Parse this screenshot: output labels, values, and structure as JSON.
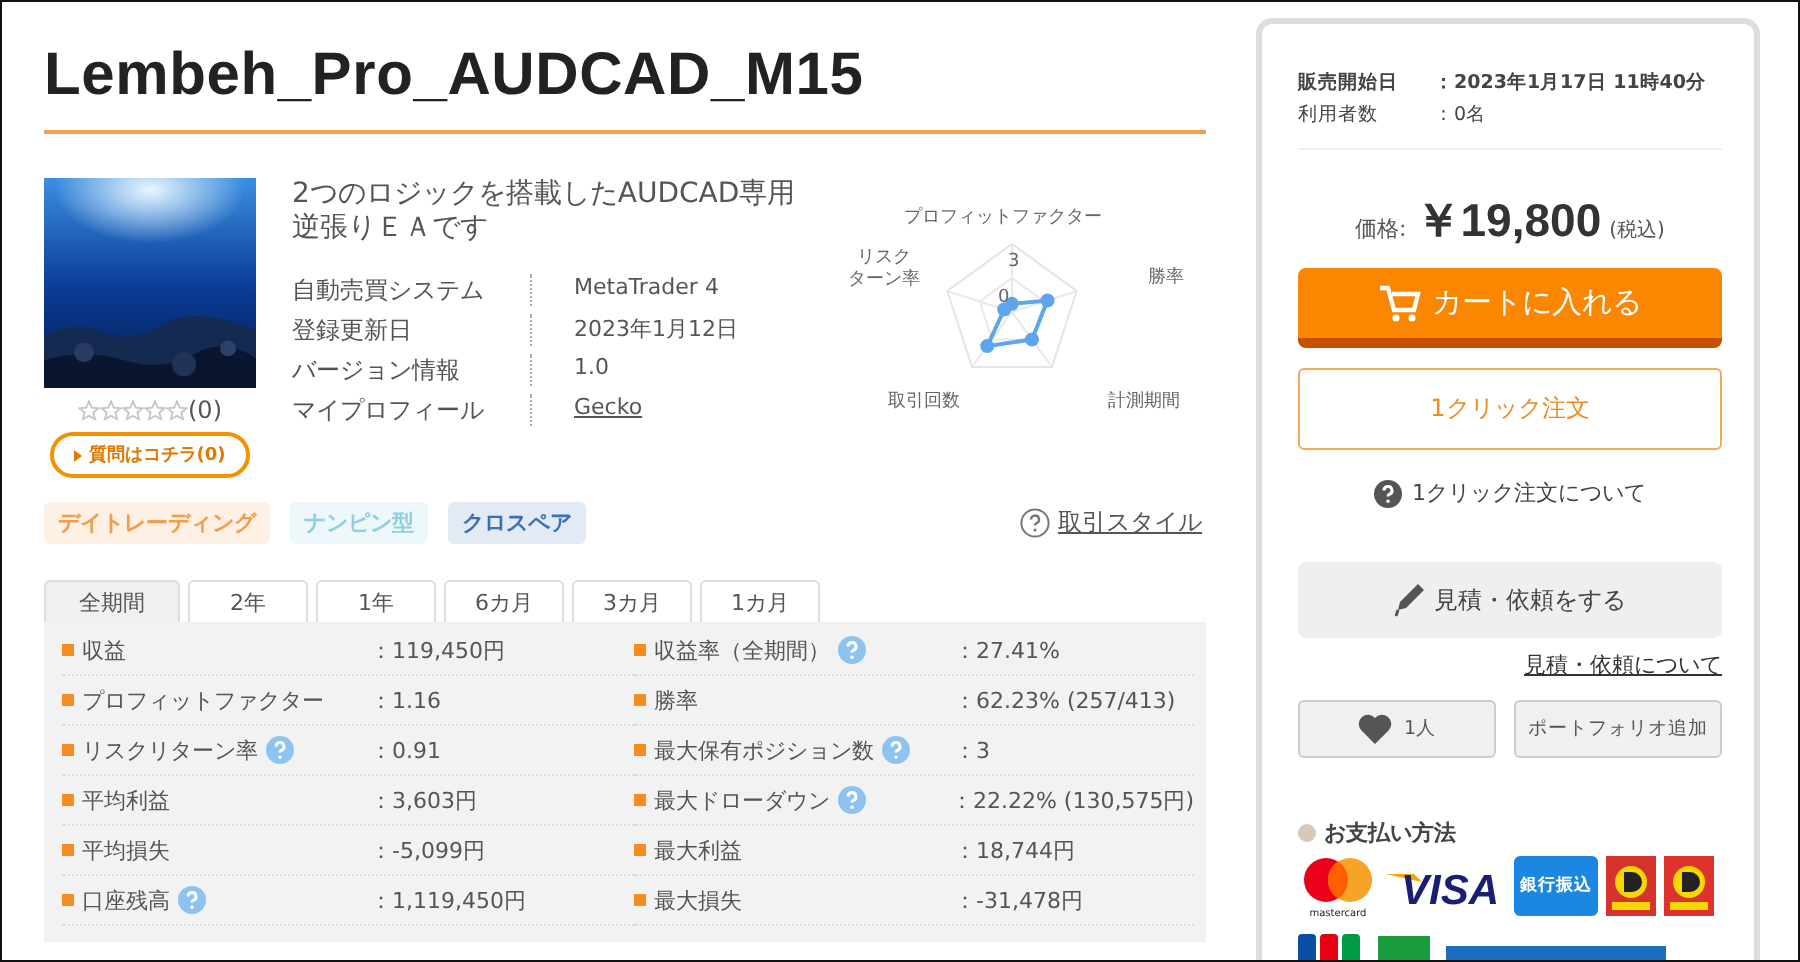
{
  "title": "Lembeh_Pro_AUDCAD_M15",
  "product": {
    "rating": {
      "stars": 0,
      "count": "(0)"
    },
    "question_button": "質問はコチラ(0)"
  },
  "description": [
    "2つのロジックを搭載したAUDCAD専用",
    "逆張りＥＡです"
  ],
  "specs": [
    {
      "label": "自動売買システム",
      "value": "MetaTrader 4",
      "kind": "text"
    },
    {
      "label": "登録更新日",
      "value": "2023年1月12日",
      "kind": "text"
    },
    {
      "label": "バージョン情報",
      "value": "1.0",
      "kind": "text"
    },
    {
      "label": "マイプロフィール",
      "value": "Gecko",
      "kind": "link"
    }
  ],
  "radar": {
    "axes": [
      {
        "lines": [
          "プロフィットファクター"
        ]
      },
      {
        "lines": [
          "勝率"
        ]
      },
      {
        "lines": [
          "計測期間"
        ]
      },
      {
        "lines": [
          "取引回数"
        ]
      },
      {
        "lines": [
          "リスク",
          "ターン率"
        ]
      }
    ],
    "ticks": [
      "3",
      "0"
    ]
  },
  "tags": [
    {
      "label": "デイトレーディング",
      "color": "#f39c4a"
    },
    {
      "label": "ナンピン型",
      "color": "#8fd0dc"
    },
    {
      "label": "クロスペア",
      "color": "#3d6fb6"
    }
  ],
  "style_link": "取引スタイル",
  "tabs": [
    {
      "label": "全期間",
      "selected": true
    },
    {
      "label": "2年",
      "selected": false
    },
    {
      "label": "1年",
      "selected": false
    },
    {
      "label": "6カ月",
      "selected": false
    },
    {
      "label": "3カ月",
      "selected": false
    },
    {
      "label": "1カ月",
      "selected": false
    }
  ],
  "stats": [
    {
      "label": "収益",
      "help": false,
      "value": "：119,450円"
    },
    {
      "label": "収益率（全期間）",
      "help": true,
      "value": "：27.41%"
    },
    {
      "label": "プロフィットファクター",
      "help": false,
      "value": "：1.16"
    },
    {
      "label": "勝率",
      "help": false,
      "value": "：62.23% (257/413)"
    },
    {
      "label": "リスクリターン率",
      "help": true,
      "value": "：0.91"
    },
    {
      "label": "最大保有ポジション数",
      "help": true,
      "value": "：3"
    },
    {
      "label": "平均利益",
      "help": false,
      "value": "：3,603円"
    },
    {
      "label": "最大ドローダウン",
      "help": true,
      "value": "：22.22% (130,575円)"
    },
    {
      "label": "平均損失",
      "help": false,
      "value": "：-5,099円"
    },
    {
      "label": "最大利益",
      "help": false,
      "value": "：18,744円"
    },
    {
      "label": "口座残高",
      "help": true,
      "value": "：1,119,450円"
    },
    {
      "label": "最大損失",
      "help": false,
      "value": "：-31,478円"
    }
  ],
  "sidebar": {
    "info": [
      {
        "label": "販売開始日",
        "value": "：2023年1月17日 11時40分",
        "bold": true
      },
      {
        "label": "利用者数",
        "value": "：0名",
        "bold": false
      }
    ],
    "price": {
      "label": "価格:",
      "amount": "￥19,800",
      "tax": "(税込)"
    },
    "cart_button": "カートに入れる",
    "one_click_button": "1クリック注文",
    "one_click_help": "1クリック注文について",
    "estimate_button": "見積・依頼をする",
    "estimate_link": "見積・依頼について",
    "like_button": "1人",
    "portfolio_button": "ポートフォリオ追加",
    "payment": {
      "title": "お支払い方法",
      "methods": [
        {
          "kind": "mastercard",
          "text": "mastercard"
        },
        {
          "kind": "visa",
          "text": "VISA"
        },
        {
          "kind": "bank",
          "text": "銀行振込"
        },
        {
          "kind": "daily"
        },
        {
          "kind": "daily"
        }
      ]
    }
  }
}
